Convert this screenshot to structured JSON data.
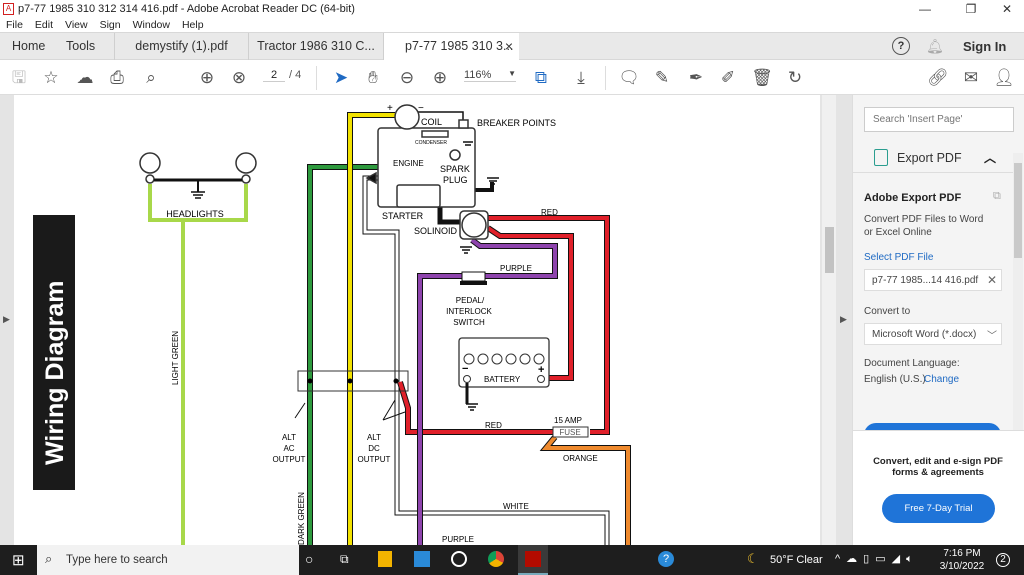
{
  "window": {
    "title": "p7-77 1985 310 312 314 416.pdf - Adobe Acrobat Reader DC (64-bit)",
    "minimize": "—",
    "restore": "❐",
    "close": "✕"
  },
  "menu": [
    "File",
    "Edit",
    "View",
    "Sign",
    "Window",
    "Help"
  ],
  "tabs": {
    "home": "Home",
    "tools": "Tools",
    "docs": [
      {
        "label": "demystify (1).pdf"
      },
      {
        "label": "Tractor 1986 310 C..."
      },
      {
        "label": "p7-77 1985 310 3...",
        "close": "×"
      }
    ],
    "help": "?",
    "signin": "Sign In"
  },
  "toolbar": {
    "page_current": "2",
    "page_total": "/ 4",
    "zoom": "116%"
  },
  "diagram": {
    "title": "Wiring Diagram",
    "labels": {
      "headlights": "HEADLIGHTS",
      "light_green": "LIGHT GREEN",
      "coil": "COIL",
      "breaker": "BREAKER POINTS",
      "condenser": "CONDENSER",
      "engine": "ENGINE",
      "spark1": "SPARK",
      "spark2": "PLUG",
      "starter": "STARTER",
      "solenoid": "SOLINOID",
      "red_top": "RED",
      "purple_top": "PURPLE",
      "pedal1": "PEDAL/",
      "pedal2": "INTERLOCK",
      "pedal3": "SWITCH",
      "battery": "BATTERY",
      "plus": "+",
      "minus": "−",
      "alt_ac1": "ALT",
      "alt_ac2": "AC",
      "alt_ac3": "OUTPUT",
      "alt_dc1": "ALT",
      "alt_dc2": "DC",
      "alt_dc3": "OUTPUT",
      "red_mid": "RED",
      "fuse_amp": "15 AMP",
      "fuse": "FUSE",
      "orange": "ORANGE",
      "white": "WHITE",
      "purple_bottom": "PURPLE",
      "dark_green": "DARK GREEN"
    },
    "wire_colors": {
      "red": "#e0202a",
      "purple": "#8e44ad",
      "green": "#2e9a3e",
      "yellow": "#f2e200",
      "light_green": "#a8d84a",
      "orange": "#ef8a2e"
    }
  },
  "panel": {
    "search_placeholder": "Search 'Insert Page'",
    "section": "Export PDF",
    "heading": "Adobe Export PDF",
    "desc1": "Convert PDF Files to Word",
    "desc2": "or Excel Online",
    "select_label": "Select PDF File",
    "file": "p7-77 1985...14 416.pdf",
    "convert_label": "Convert to",
    "convert_value": "Microsoft Word (*.docx)",
    "lang_label": "Document Language:",
    "lang_value": "English (U.S.)",
    "change": "Change",
    "promo1": "Convert, edit and e-sign PDF",
    "promo2": "forms & agreements",
    "trial": "Free 7-Day Trial"
  },
  "taskbar": {
    "search_placeholder": "Type here to search",
    "weather": "50°F  Clear",
    "time": "7:16 PM",
    "date": "3/10/2022",
    "notifications": "2"
  }
}
